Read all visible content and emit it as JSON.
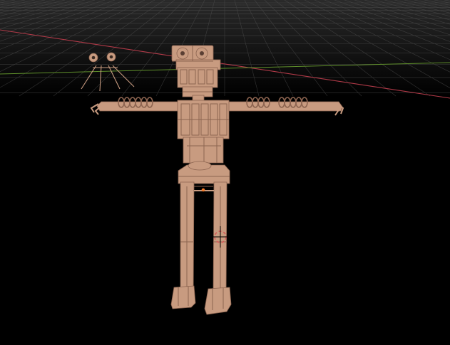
{
  "viewport": {
    "background_color": "#000000",
    "grid_color": "#5a5a5a",
    "x_axis_color": "#b13a48",
    "y_axis_color": "#5f8f2b",
    "model_color": "#c89b80",
    "model_shadow_color": "#8c6450",
    "cursor_color": "#d65555",
    "origin_color": "#f07a2a"
  },
  "scene": {
    "objects": [
      {
        "name": "robot-skeleton-model",
        "type": "mesh"
      },
      {
        "name": "animatronic-eyes-object",
        "type": "mesh"
      }
    ],
    "icons": [
      "3d-cursor-icon",
      "origin-point-icon"
    ]
  }
}
